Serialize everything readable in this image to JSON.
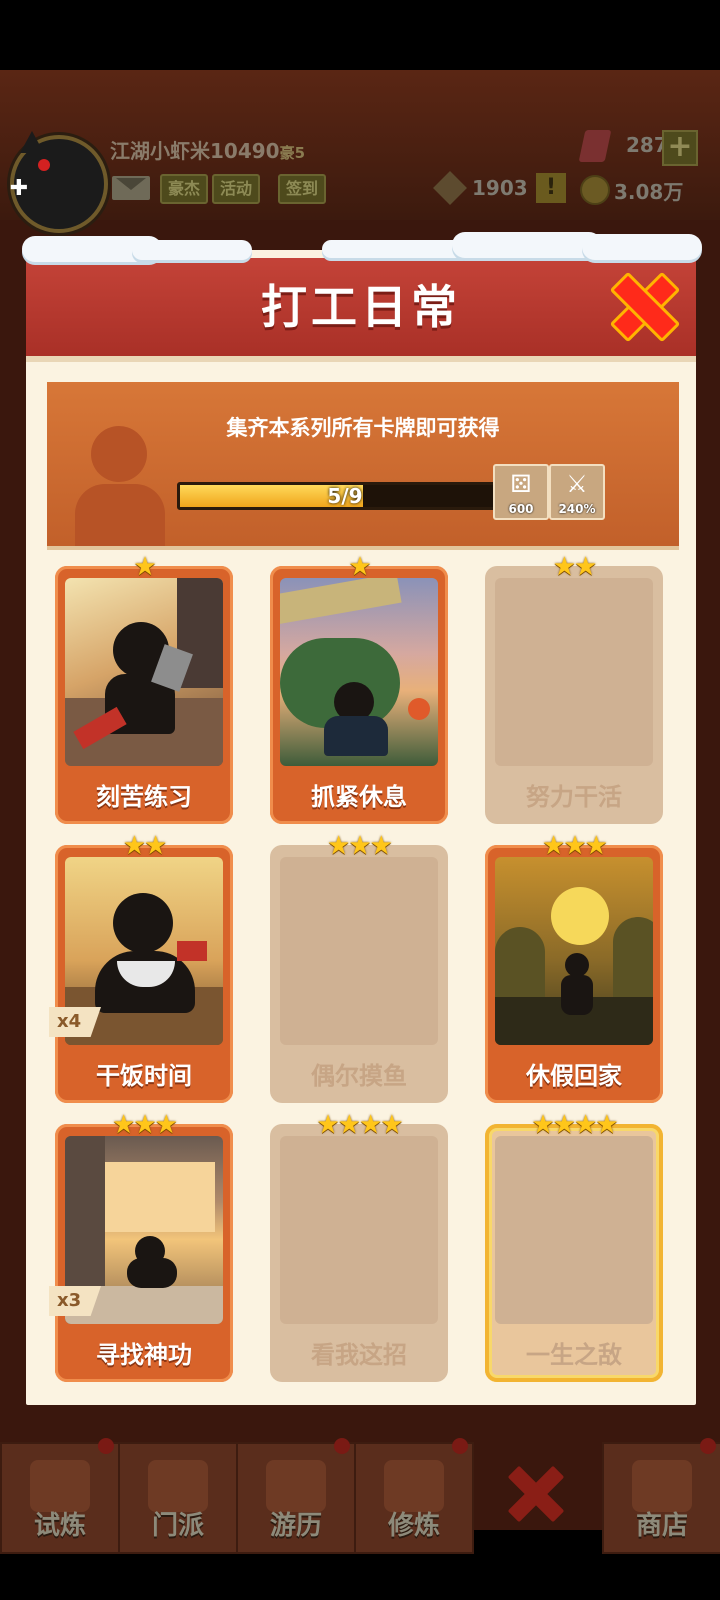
{
  "header": {
    "player_name": "江湖小虾米10490",
    "vip_label": "豪5",
    "buttons": [
      "豪杰",
      "活动",
      "签到"
    ],
    "gems": "287",
    "tokens": "1903",
    "coins": "3.08万",
    "alert": "!",
    "plus": "+"
  },
  "modal": {
    "title": "打工日常",
    "banner_text": "集齐本系列所有卡牌即可获得",
    "progress": {
      "current": 5,
      "total": 9,
      "label": "5/9"
    },
    "rewards": [
      {
        "icon": "dice-icon",
        "value": "600"
      },
      {
        "icon": "sword-icon",
        "value": "240%"
      }
    ],
    "cards": [
      {
        "name": "刻苦练习",
        "stars": "★",
        "owned": true,
        "count": ""
      },
      {
        "name": "抓紧休息",
        "stars": "★",
        "owned": true,
        "count": ""
      },
      {
        "name": "努力干活",
        "stars": "★★",
        "owned": false,
        "count": ""
      },
      {
        "name": "干饭时间",
        "stars": "★★",
        "owned": true,
        "count": "x4"
      },
      {
        "name": "偶尔摸鱼",
        "stars": "★★★",
        "owned": false,
        "count": ""
      },
      {
        "name": "休假回家",
        "stars": "★★★",
        "owned": true,
        "count": ""
      },
      {
        "name": "寻找神功",
        "stars": "★★★",
        "owned": true,
        "count": "x3"
      },
      {
        "name": "看我这招",
        "stars": "★★★★",
        "owned": false,
        "count": ""
      },
      {
        "name": "一生之敌",
        "stars": "★★★★",
        "owned": false,
        "count": ""
      }
    ]
  },
  "nav": {
    "tabs": [
      "试炼",
      "门派",
      "游历",
      "修炼",
      "商店"
    ]
  },
  "colors": {
    "title_red": "#c44338",
    "card_orange": "#d8632a",
    "card_locked": "#d9bea0",
    "star_gold": "#ffc61a",
    "progress_gold": "#f0a51c"
  }
}
